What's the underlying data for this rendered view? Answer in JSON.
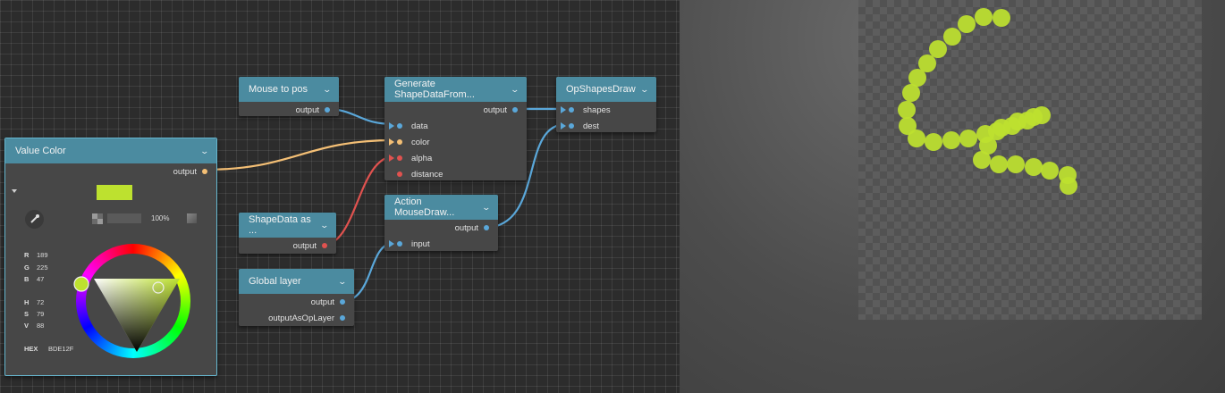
{
  "nodes": {
    "mouse_to_pos": {
      "title": "Mouse to pos",
      "output": "output"
    },
    "generate_shape": {
      "title": "Generate ShapeDataFrom...",
      "output": "output",
      "inputs": [
        "data",
        "color",
        "alpha",
        "distance"
      ]
    },
    "op_shapes_draw": {
      "title": "OpShapesDraw",
      "inputs": [
        "shapes",
        "dest"
      ]
    },
    "value_color": {
      "title": "Value Color",
      "output": "output",
      "opacity": "100%",
      "rgb": {
        "r_label": "R",
        "r": "189",
        "g_label": "G",
        "g": "225",
        "b_label": "B",
        "b": "47"
      },
      "hsv": {
        "h_label": "H",
        "h": "72",
        "s_label": "S",
        "s": "79",
        "v_label": "V",
        "v": "88"
      },
      "hex_label": "HEX",
      "hex": "BDE12F"
    },
    "shapedata_as": {
      "title": "ShapeData as ...",
      "output": "output"
    },
    "action_mousedraw": {
      "title": "Action MouseDraw...",
      "output": "output",
      "input": "input"
    },
    "global_layer": {
      "title": "Global layer",
      "outputs": [
        "output",
        "outputAsOpLayer"
      ]
    }
  },
  "colors": {
    "header": "#4b8ba0",
    "blue_port": "#5aa7d9",
    "orange_port": "#f4bf75",
    "red_port": "#e0524f",
    "swatch": "#bde12f",
    "paint_dot": "#bde12f"
  },
  "icons": [
    "chevron-down-icon",
    "eyedropper-icon",
    "checker-icon",
    "triangle-down-icon"
  ]
}
